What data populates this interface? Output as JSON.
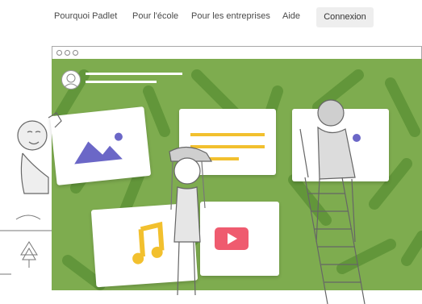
{
  "nav": {
    "items": [
      {
        "label": "Pourquoi Padlet"
      },
      {
        "label": "Pour l'école"
      },
      {
        "label": "Pour les entreprises"
      },
      {
        "label": "Aide"
      }
    ],
    "login_label": "Connexion"
  },
  "colors": {
    "board_green": "#7eac4f",
    "board_pattern": "#5f9438",
    "accent_yellow": "#f2c02e",
    "accent_purple": "#6b67c7",
    "accent_red": "#ef5b6f",
    "nav_button_bg": "#eeeeee"
  },
  "illustration": {
    "icons": [
      "image-icon",
      "document-lines-icon",
      "music-note-icon",
      "video-play-icon",
      "avatar-icon"
    ]
  }
}
